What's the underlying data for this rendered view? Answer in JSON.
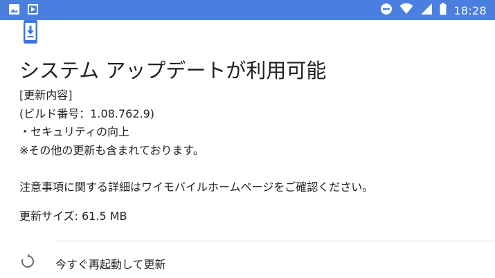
{
  "status_bar": {
    "time": "18:28",
    "colors": {
      "background": "#4a7ee0",
      "foreground": "#ffffff"
    },
    "left_icons": [
      "image-icon",
      "play-store-icon"
    ],
    "right_icons": [
      "do-not-disturb-icon",
      "wifi-icon",
      "signal-icon",
      "battery-icon"
    ]
  },
  "update": {
    "icon": "system-update-icon",
    "icon_color": "#3b76e0",
    "title": "システム アップデートが利用可能",
    "notes": [
      "[更新内容]",
      "(ビルド番号：1.08.762.9)",
      "・セキュリティの向上",
      "※その他の更新も含まれております。"
    ],
    "notice": "注意事項に関する詳細はワイモバイルホームページをご確認ください。",
    "size_text": "更新サイズ: 61.5 MB"
  },
  "action": {
    "icon": "restart-icon",
    "label": "今すぐ再起動して更新"
  }
}
